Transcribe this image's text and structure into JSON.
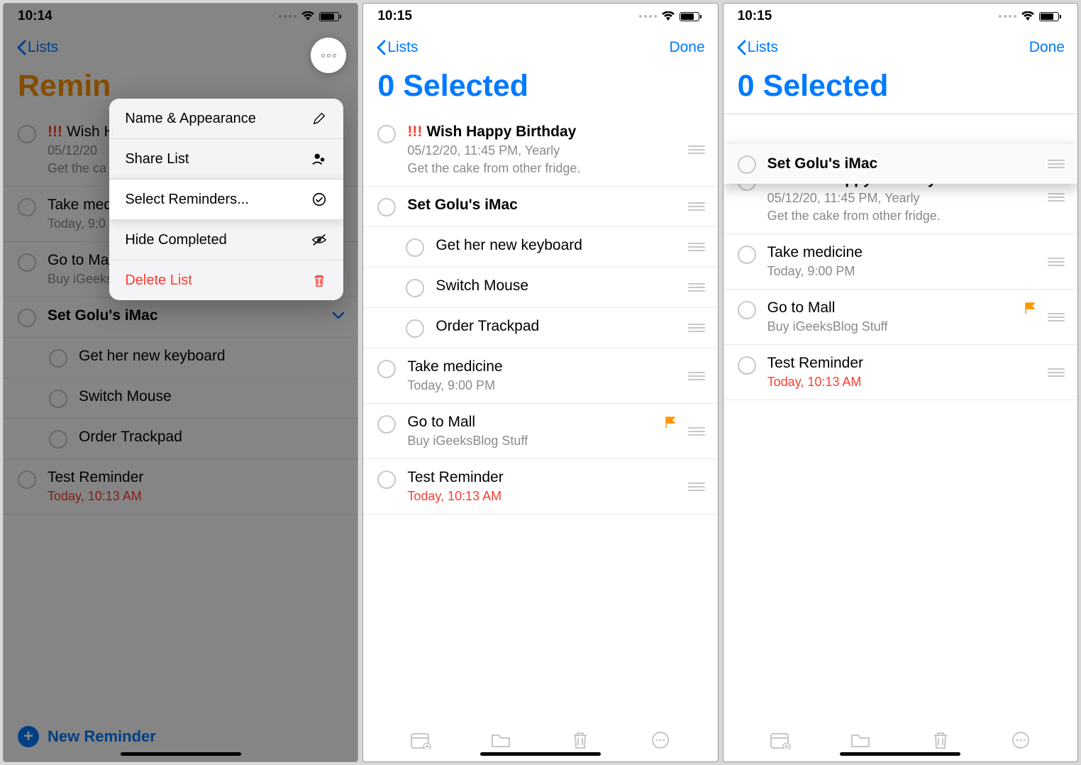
{
  "screen1": {
    "time": "10:14",
    "back_label": "Lists",
    "title": "Remin",
    "menu": {
      "name_appearance": "Name & Appearance",
      "share": "Share List",
      "select": "Select Reminders...",
      "hide": "Hide Completed",
      "delete": "Delete List"
    },
    "items": [
      {
        "priority": "!!!",
        "title": "Wish H",
        "sub": "05/12/20",
        "sub2": "Get the ca"
      },
      {
        "title": "Take med",
        "sub": "Today, 9:0"
      },
      {
        "title": "Go to Mall",
        "sub": "Buy iGeeksBlog Stuff",
        "flag": true
      },
      {
        "title": "Set Golu's iMac",
        "bold": true,
        "expand": true
      },
      {
        "title": "Get her new keyboard",
        "indent": true
      },
      {
        "title": "Switch Mouse",
        "indent": true
      },
      {
        "title": "Order Trackpad",
        "indent": true
      },
      {
        "title": "Test Reminder",
        "sub": "Today, 10:13 AM",
        "subred": true
      }
    ],
    "new_reminder": "New Reminder"
  },
  "screen2": {
    "time": "10:15",
    "back_label": "Lists",
    "done": "Done",
    "title": "0 Selected",
    "items": [
      {
        "priority": "!!!",
        "title": "Wish Happy Birthday",
        "sub": "05/12/20, 11:45 PM, Yearly",
        "sub2": "Get the cake from other fridge."
      },
      {
        "title": "Set Golu's iMac",
        "bold": true
      },
      {
        "title": "Get her new keyboard",
        "indent": true
      },
      {
        "title": "Switch Mouse",
        "indent": true
      },
      {
        "title": "Order Trackpad",
        "indent": true
      },
      {
        "title": "Take medicine",
        "sub": "Today, 9:00 PM"
      },
      {
        "title": "Go to Mall",
        "sub": "Buy iGeeksBlog Stuff",
        "flag": true
      },
      {
        "title": "Test Reminder",
        "sub": "Today, 10:13 AM",
        "subred": true
      }
    ]
  },
  "screen3": {
    "time": "10:15",
    "back_label": "Lists",
    "done": "Done",
    "title": "0 Selected",
    "dragged": {
      "title": "Set Golu's iMac",
      "bold": true
    },
    "items": [
      {
        "priority": "!!!",
        "title": "Wish Happy Birthday",
        "sub": "05/12/20, 11:45 PM, Yearly",
        "sub2": "Get the cake from other fridge."
      },
      {
        "title": "Take medicine",
        "sub": "Today, 9:00 PM"
      },
      {
        "title": "Go to Mall",
        "sub": "Buy iGeeksBlog Stuff",
        "flag": true
      },
      {
        "title": "Test Reminder",
        "sub": "Today, 10:13 AM",
        "subred": true
      }
    ]
  }
}
